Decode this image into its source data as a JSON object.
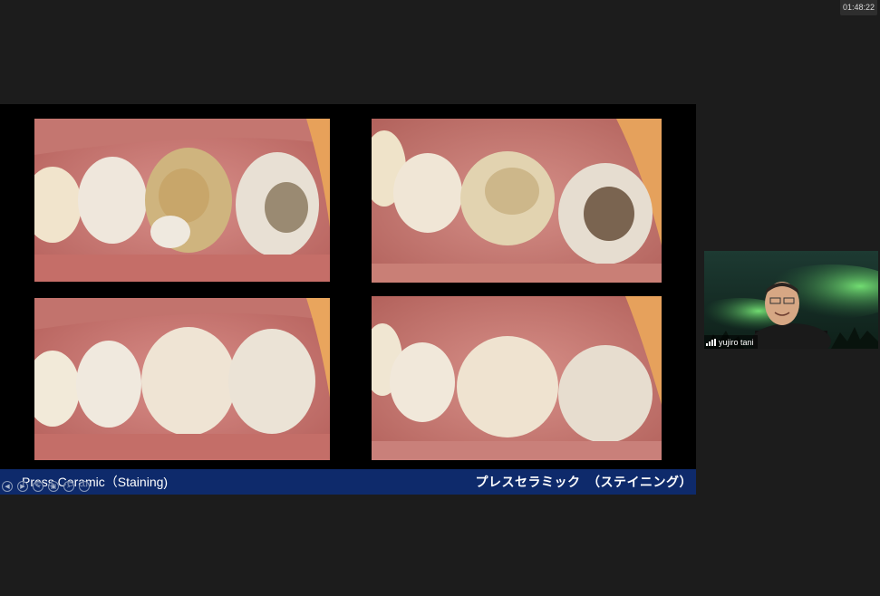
{
  "timer": {
    "elapsed": "01:48:22"
  },
  "slide": {
    "caption_en": "Press Ceramic（Staining)",
    "caption_jp": "プレスセラミック　（ステイニング）"
  },
  "controls": [
    "prev-slide",
    "next-slide",
    "pen",
    "screen",
    "zoom",
    "more"
  ],
  "participant": {
    "name": "yujiro tani"
  },
  "colors": {
    "caption_bar": "#0e2a6b",
    "background": "#1c1c1c"
  }
}
